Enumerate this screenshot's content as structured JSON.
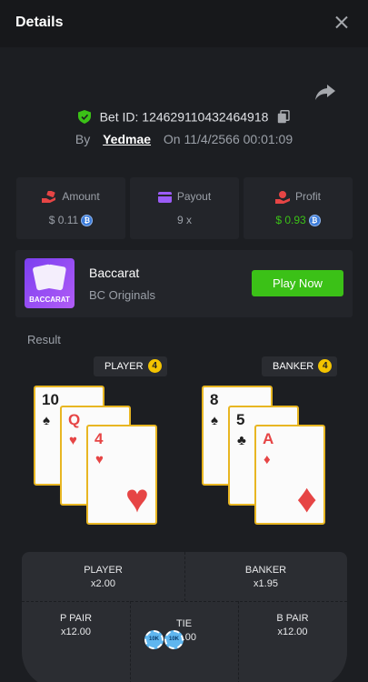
{
  "header": {
    "title": "Details"
  },
  "bet": {
    "id_label": "Bet ID: 124629110432464918",
    "by_label": "By",
    "user": "Yedmae",
    "on_label": "On",
    "date": "11/4/2566 00:01:09"
  },
  "stats": [
    {
      "label": "Amount",
      "value": "$ 0.11",
      "icon": "money-hand-icon",
      "color": "#e64545"
    },
    {
      "label": "Payout",
      "value": "9 x",
      "icon": "wallet-icon",
      "color": "#9b5cf6"
    },
    {
      "label": "Profit",
      "value": "$ 0.93",
      "icon": "profit-hand-icon",
      "color": "#3bc117"
    }
  ],
  "game": {
    "thumb_label": "BACCARAT",
    "name": "Baccarat",
    "provider": "BC Originals",
    "play_label": "Play Now"
  },
  "result": {
    "label": "Result",
    "player": {
      "label": "PLAYER",
      "score": "4",
      "cards": [
        {
          "rank": "10",
          "suit": "♠",
          "color": "black"
        },
        {
          "rank": "Q",
          "suit": "♥",
          "color": "red"
        },
        {
          "rank": "4",
          "suit": "♥",
          "color": "red"
        }
      ]
    },
    "banker": {
      "label": "BANKER",
      "score": "4",
      "cards": [
        {
          "rank": "8",
          "suit": "♠",
          "color": "black"
        },
        {
          "rank": "5",
          "suit": "♣",
          "color": "black"
        },
        {
          "rank": "A",
          "suit": "♦",
          "color": "red"
        }
      ]
    }
  },
  "table": {
    "player": {
      "name": "PLAYER",
      "odds": "x2.00"
    },
    "banker": {
      "name": "BANKER",
      "odds": "x1.95"
    },
    "p_pair": {
      "name": "P PAIR",
      "odds": "x12.00"
    },
    "tie": {
      "name": "TIE",
      "odds": "x8.00"
    },
    "b_pair": {
      "name": "B PAIR",
      "odds": "x12.00"
    },
    "chip_label": "10K"
  }
}
